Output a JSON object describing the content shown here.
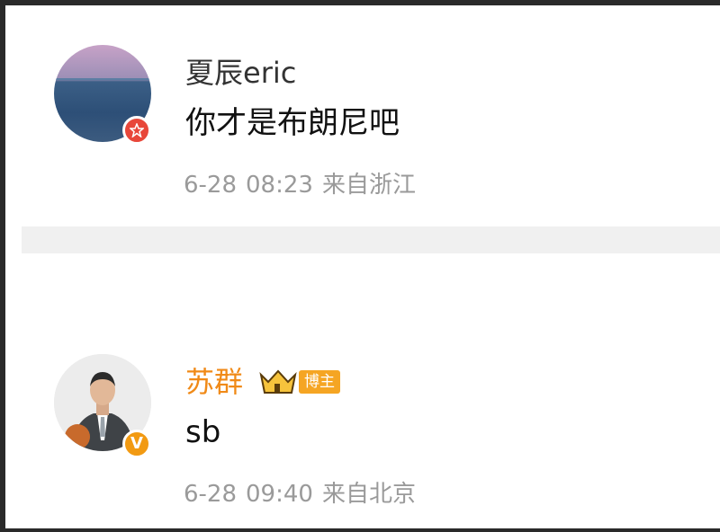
{
  "comments": [
    {
      "username": "夏辰eric",
      "text": "你才是布朗尼吧",
      "date": "6-28",
      "time": "08:23",
      "location": "来自浙江",
      "badge_icon": "red-star-badge-icon",
      "badge_color": "#e8473a"
    },
    {
      "username": "苏群",
      "text": "sb",
      "date": "6-28",
      "time": "09:40",
      "location": "来自北京",
      "host_tag": "博主",
      "badge_icon": "verified-v-badge-icon",
      "badge_color": "#f29a12"
    }
  ],
  "colors": {
    "divider": "#f0f0f0",
    "host_name": "#f08a18",
    "meta_text": "#9a9a9a"
  }
}
